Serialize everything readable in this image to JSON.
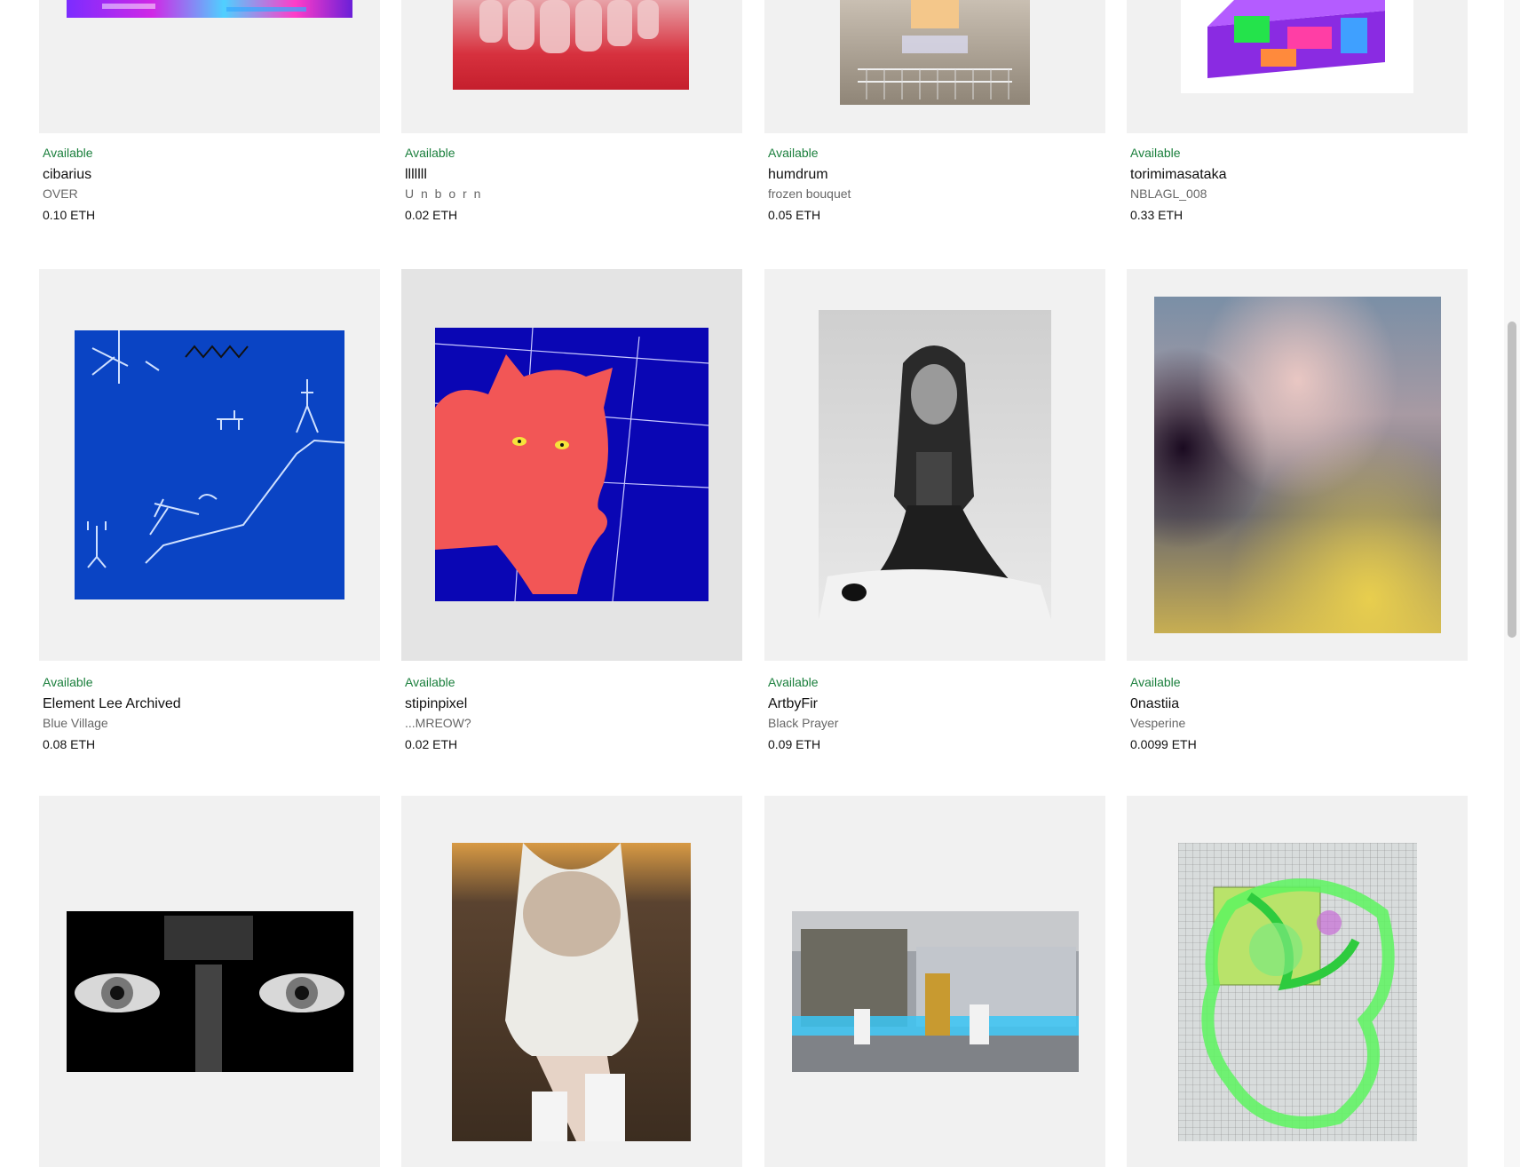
{
  "cards": [
    {
      "status": "Available",
      "artist": "cibarius",
      "title": "OVER",
      "price": "0.10 ETH"
    },
    {
      "status": "Available",
      "artist": "lllllll",
      "title": "U n b o r n",
      "price": "0.02 ETH"
    },
    {
      "status": "Available",
      "artist": "humdrum",
      "title": "frozen bouquet",
      "price": "0.05 ETH"
    },
    {
      "status": "Available",
      "artist": "torimimasataka",
      "title": "NBLAGL_008",
      "price": "0.33 ETH"
    },
    {
      "status": "Available",
      "artist": "Element Lee Archived",
      "title": "Blue Village",
      "price": "0.08 ETH"
    },
    {
      "status": "Available",
      "artist": "stipinpixel",
      "title": "...MREOW?",
      "price": "0.02 ETH"
    },
    {
      "status": "Available",
      "artist": "ArtbyFir",
      "title": "Black Prayer",
      "price": "0.09 ETH"
    },
    {
      "status": "Available",
      "artist": "0nastiia",
      "title": "Vesperine",
      "price": "0.0099 ETH"
    }
  ],
  "artwork_names": [
    "glitch-purple-artwork",
    "red-teeth-artwork",
    "fridge-artwork",
    "glitch-cube-artwork",
    "blue-village-pixel-artwork",
    "red-cat-pixel-artwork",
    "black-prayer-photo",
    "vesperine-blur-artwork",
    "eyes-binary-artwork",
    "white-dress-portrait",
    "city-phonebooth-artwork",
    "green-liquid-artwork"
  ]
}
